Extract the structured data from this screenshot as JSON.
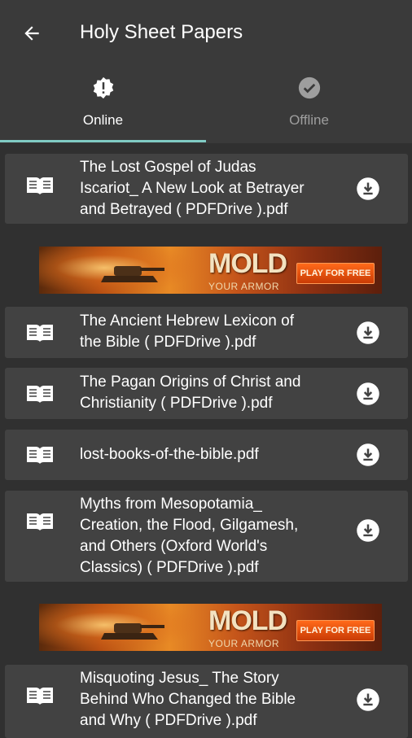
{
  "header": {
    "title": "Holy Sheet Papers",
    "back_icon": "arrow-back-icon"
  },
  "tabs": [
    {
      "label": "Online",
      "icon": "alert-badge-icon",
      "active": true
    },
    {
      "label": "Offline",
      "icon": "check-badge-icon",
      "active": false
    }
  ],
  "colors": {
    "background": "#303030",
    "appbar": "#3a3a3a",
    "card": "#424242",
    "indicator": "#80cbc4",
    "inactive_tab": "#9e9e9e"
  },
  "files": [
    {
      "title": "The Lost Gospel of Judas Iscariot_ A New Look at Betrayer and Betrayed ( PDFDrive ).pdf",
      "lines": [
        "The Lost Gospel of Judas",
        "Iscariot_ A New Look at Betrayer",
        "and Betrayed ( PDFDrive ).pdf"
      ]
    },
    {
      "title": "The Ancient Hebrew Lexicon of the Bible ( PDFDrive ).pdf",
      "lines": [
        "The Ancient Hebrew Lexicon of",
        "the Bible ( PDFDrive ).pdf"
      ]
    },
    {
      "title": "The Pagan Origins of Christ and Christianity ( PDFDrive ).pdf",
      "lines": [
        "The Pagan Origins of Christ and",
        "Christianity ( PDFDrive ).pdf"
      ]
    },
    {
      "title": "lost-books-of-the-bible.pdf",
      "lines": [
        "lost-books-of-the-bible.pdf"
      ]
    },
    {
      "title": "Myths from Mesopotamia_ Creation, the Flood, Gilgamesh, and Others (Oxford World's Classics)   ( PDFDrive ).pdf",
      "lines": [
        "Myths from Mesopotamia_",
        "Creation, the Flood, Gilgamesh,",
        "and Others (Oxford World's",
        "Classics)   ( PDFDrive ).pdf"
      ]
    },
    {
      "title": "Misquoting Jesus_ The Story Behind Who Changed the Bible and Why ( PDFDrive ).pdf",
      "lines": [
        "Misquoting Jesus_ The Story",
        "Behind Who Changed the Bible",
        "and Why ( PDFDrive ).pdf"
      ]
    }
  ],
  "ads": [
    {
      "headline": "MOLD",
      "subline": "YOUR ARMOR",
      "cta": "PLAY FOR FREE"
    },
    {
      "headline": "MOLD",
      "subline": "YOUR ARMOR",
      "cta": "PLAY FOR FREE"
    }
  ]
}
